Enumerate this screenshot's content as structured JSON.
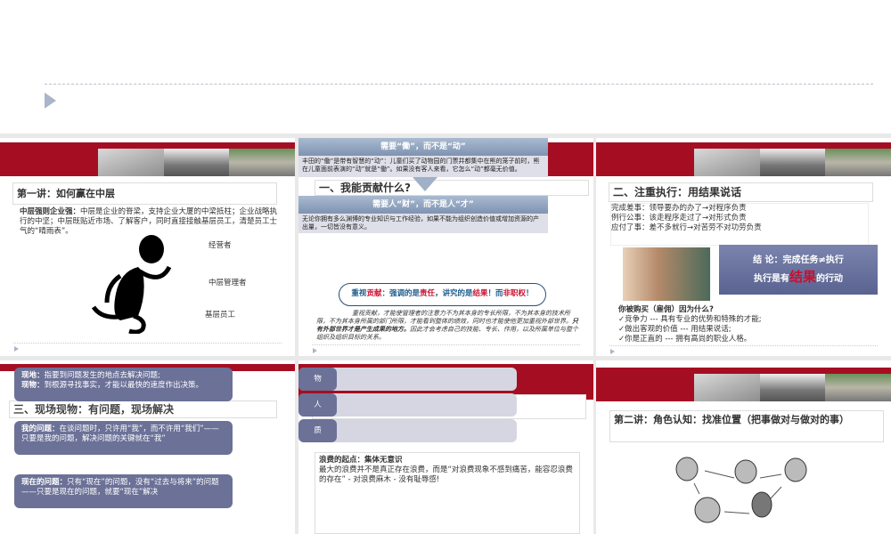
{
  "slides": [
    {
      "title": "第一讲：如何赢在中层",
      "body_bold": "中层强则企业强：",
      "body": "中层是企业的脊梁，支持企业大厦的中梁抵柱；企业战略执行的中坚；中层既贴近市场、了解客户，同时直接接触基层员工，清楚员工士气的“晴雨表”。",
      "labels": [
        "经营者",
        "中层管理者",
        "基层员工"
      ]
    },
    {
      "box1_title": "需要“働”，而不是“动”",
      "box1_text": "丰田的“働”是带有智慧的“动”：儿童们买了动物园的门票并都集中在熊的笼子前时，熊在儿童面前表演的“动”就是“働”。如果没有客人来看，它怎么“动”都毫无价值。",
      "title": "一、我能贡献什么?",
      "box2_title": "需要人“财”，而不是人“才”",
      "box2_text": "无论你拥有多么渊博的专业知识与工作经验，如果不能为组织创造价值或增加资源的产出量，一切皆没有意义。",
      "callout": [
        "重视",
        "贡献",
        "：强调的是",
        "责任",
        "，讲究的是",
        "结果",
        "！而",
        "非职权",
        "！"
      ],
      "para": "重视贡献，才能使管理者的注意力不为其本身的专长所限，不为其本身的技术所限，不为其本身所属的部门所限，才能看到整体的绩效，同时也才能使他更加重视外部世界。",
      "para_bold": "只有外部世界才是产生成果的地方。",
      "para_end": "因此才会考虑自己的技能、专长、作用，以及所属单位与整个组织及组织目标的关系。"
    },
    {
      "title": "二、注重执行：用结果说话",
      "bullets": [
        "完成差事：领导要办的办了→对程序负责",
        "例行公事：该走程序走过了→对形式负责",
        "应付了事：差不多就行→对苦劳不对功劳负责"
      ],
      "conclusion1": "结 论：完成任务≠执行",
      "conclusion2a": "执行是有",
      "conclusion2b": "结果",
      "conclusion2c": "的行动",
      "q": "你被购买（雇佣）因为什么?",
      "checks": [
        "✓竞争力 --- 具有专业的优势和特殊的才能;",
        "✓做出客观的价值 --- 用结果说话;",
        "✓你是正直的 --- 拥有高尚的职业人格。"
      ]
    },
    {
      "title": "三、现场现物：有问题，现场解决",
      "p1a": "现地：",
      "p1b": "指要到问题发生的地点去解决问题;",
      "p1c": "现物：",
      "p1d": "到根源寻找事实，才能以最快的速度作出决策。",
      "p2a": "我的问题：",
      "p2b": "在谈问题时，只许用“我”，而不许用“我们”——只要是我的问题，解决问题的关键就在“我”",
      "p3a": "现在的问题：",
      "p3b": "只有“现在”的问题，没有“过去与将来”的问题——只要是现在的问题，就要“现在”解决"
    },
    {
      "tags": [
        "物",
        "人",
        "质"
      ],
      "title": "四、消除浪费：降低成本就是增加利润",
      "bullets": [
        "浪费的起点：集体无意识",
        "最大的浪费并不是真正存在浪费，而是“对浪费现象不感到痛苦，能容忍浪费的存在” - 对浪费麻木 - 没有耻辱感!"
      ]
    },
    {
      "title": "第二讲：角色认知：找准位置（把事做对与做对的事）"
    }
  ]
}
